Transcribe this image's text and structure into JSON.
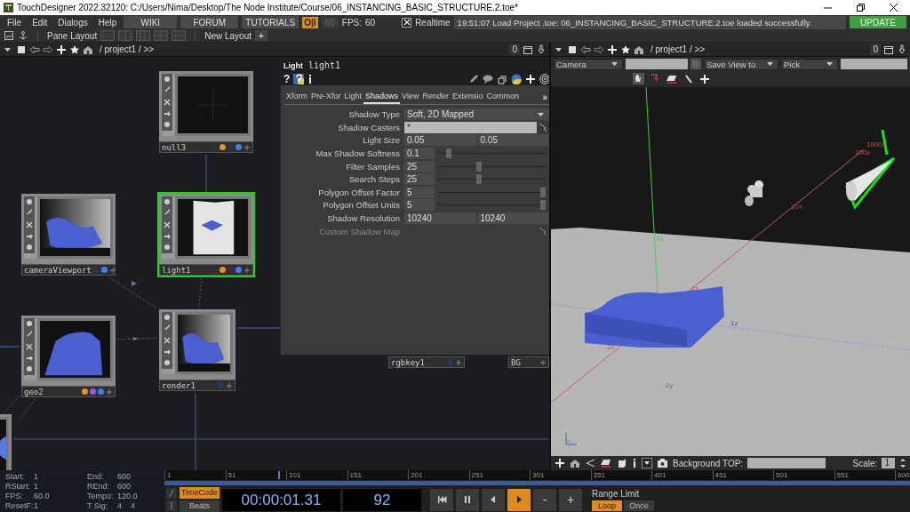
{
  "window": {
    "title": "TouchDesigner 2022.32120: C:/Users/Nima/Desktop/The Node Institute/Course/06_INSTANCING_BASIC_STRUCTURE.2.toe*"
  },
  "menu": [
    "File",
    "Edit",
    "Dialogs",
    "Help"
  ],
  "links": [
    "WIKI",
    "FORUM",
    "TUTORIALS"
  ],
  "toolbar": {
    "perform": "O|I",
    "fps_cap": "60",
    "fps_label": "FPS:",
    "fps_value": "60",
    "realtime": {
      "label": "Realtime",
      "checked": true
    },
    "message": "19:51:07 Load Project .toe: 06_INSTANCING_BASIC_STRUCTURE.2.toe loaded successfully.",
    "update": "UPDATE"
  },
  "layout_bar": {
    "pane_layout": "Pane Layout",
    "new_layout": "New Layout",
    "add": "+"
  },
  "panes": [
    {
      "path": "/ project1 / >>",
      "count": "0"
    },
    {
      "path": "/ project1 / >>",
      "count": "0"
    }
  ],
  "network": {
    "nodes": [
      {
        "name": "null3",
        "kind": "empty",
        "selected": false,
        "flags": [
          {
            "color": "#e8921c"
          },
          {
            "color": "#35304a"
          },
          {
            "color": "#3b82f0"
          }
        ]
      },
      {
        "name": "light1",
        "kind": "light",
        "selected": true,
        "flags": [
          {
            "color": "#e8921c"
          },
          {
            "color": "#35304a"
          },
          {
            "color": "#3b82f0"
          }
        ]
      },
      {
        "name": "cameraViewport",
        "kind": "render",
        "selected": false,
        "flags": [
          {
            "color": "#35304a"
          },
          {
            "color": "#3b82f0"
          }
        ]
      },
      {
        "name": "geo2",
        "kind": "geometry",
        "selected": false,
        "flags": [
          {
            "color": "#e8921c"
          },
          {
            "color": "#8a5cf0"
          },
          {
            "color": "#3b82f0"
          }
        ]
      },
      {
        "name": "render1",
        "kind": "render",
        "selected": false,
        "flags": [
          {
            "color": "#263a66"
          }
        ]
      },
      {
        "kind": "sphere",
        "selected": false
      },
      {
        "name": "rgbkey1",
        "kind": "label",
        "selected": false,
        "flags": [
          {
            "color": "#263a66"
          }
        ]
      },
      {
        "name": "BG",
        "kind": "label",
        "selected": false
      }
    ]
  },
  "parameters": {
    "type": "Light",
    "name": "light1",
    "help": "?",
    "more": "»",
    "tabs": [
      {
        "label": "Xform",
        "selected": false
      },
      {
        "label": "Pre-Xfor",
        "selected": false
      },
      {
        "label": "Light",
        "selected": false
      },
      {
        "label": "Shadows",
        "selected": true
      },
      {
        "label": "View",
        "selected": false
      },
      {
        "label": "Render",
        "selected": false
      },
      {
        "label": "Extensio",
        "selected": false
      },
      {
        "label": "Common",
        "selected": false
      }
    ],
    "rows": [
      {
        "label": "Shadow Type",
        "kind": "menu",
        "value": "Soft, 2D Mapped"
      },
      {
        "label": "Shadow Casters",
        "kind": "text",
        "value": "*"
      },
      {
        "label": "Light Size",
        "kind": "pair",
        "values": [
          "0.05",
          "0.05"
        ]
      },
      {
        "label": "Max Shadow Softness",
        "kind": "slider",
        "value": "0.1",
        "level": 0.1
      },
      {
        "label": "Filter Samples",
        "kind": "slider",
        "value": "25",
        "level": 0.38
      },
      {
        "label": "Search Steps",
        "kind": "slider",
        "value": "25",
        "level": 0.38
      },
      {
        "label": "Polygon Offset Factor",
        "kind": "slider",
        "value": "5",
        "level": 1
      },
      {
        "label": "Polygon Offset Units",
        "kind": "slider",
        "value": "5",
        "level": 1
      },
      {
        "label": "Shadow Resolution",
        "kind": "pair",
        "values": [
          "10240",
          "10240"
        ]
      },
      {
        "label": "Custom Shadow Map",
        "kind": "disabled"
      }
    ]
  },
  "viewport": {
    "camera": "Camera",
    "save_view": "Save View to",
    "pick": "Pick",
    "axis_labels": [
      "1000x",
      "100x",
      "10x",
      "1y",
      "1x",
      "1z",
      "-1x",
      "-1y"
    ],
    "background_label": "Background TOP:",
    "scale_label": "Scale:",
    "scale_value": "1"
  },
  "timeline": {
    "ticks": [
      "1",
      "51",
      "101",
      "151",
      "201",
      "251",
      "301",
      "351",
      "401",
      "451",
      "501",
      "551",
      "600"
    ],
    "level": 0.152,
    "info": [
      {
        "label": "Start:",
        "value": "1"
      },
      {
        "label": "End:",
        "value": "600"
      },
      {
        "label": "RStart:",
        "value": "1"
      },
      {
        "label": "REnd:",
        "value": "600"
      },
      {
        "label": "FPS:",
        "value": "60.0"
      },
      {
        "label": "Tempo:",
        "value": "120.0"
      },
      {
        "label": "ResetF:",
        "value": "1"
      },
      {
        "label": "T Sig:",
        "value": "4    4"
      }
    ],
    "modes": [
      {
        "label": "TimeCode",
        "selected": true
      },
      {
        "label": "Beats",
        "selected": false
      }
    ],
    "timecode": "00:00:01.31",
    "frame": "92",
    "transport": [
      {
        "kind": "rewind",
        "selected": false
      },
      {
        "kind": "pause",
        "selected": false
      },
      {
        "kind": "back",
        "selected": false
      },
      {
        "kind": "play",
        "selected": true
      },
      {
        "kind": "text",
        "label": "-",
        "selected": false
      },
      {
        "kind": "text",
        "label": "+",
        "selected": false
      }
    ],
    "range_label": "Range Limit",
    "range": [
      {
        "label": "Loop",
        "selected": true
      },
      {
        "label": "Once",
        "selected": false
      }
    ]
  }
}
